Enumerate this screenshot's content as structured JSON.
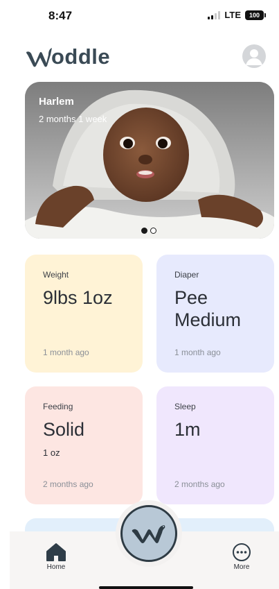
{
  "status_bar": {
    "time": "8:47",
    "network": "LTE",
    "battery": "100"
  },
  "header": {
    "brand_text": "oddle",
    "brand_full": "Woddle",
    "profile_icon": "user-avatar-icon"
  },
  "hero": {
    "name": "Harlem",
    "age": "2 months 1 week",
    "carousel": {
      "count": 2,
      "active_index": 0
    }
  },
  "cards": {
    "weight": {
      "title": "Weight",
      "value": "9lbs 1oz",
      "time": "1 month ago"
    },
    "diaper": {
      "title": "Diaper",
      "value": "Pee Medium",
      "time": "1 month ago"
    },
    "feeding": {
      "title": "Feeding",
      "value": "Solid",
      "sub": "1 oz",
      "time": "2 months ago"
    },
    "sleep": {
      "title": "Sleep",
      "value": "1m",
      "time": "2 months ago"
    }
  },
  "nav": {
    "home_label": "Home",
    "more_label": "More",
    "home_icon": "home-icon",
    "more_icon": "more-icon",
    "center_icon": "woddle-logo-icon"
  },
  "colors": {
    "brand": "#3a4a55",
    "weight_bg": "#fff3d6",
    "diaper_bg": "#e7eafd",
    "feeding_bg": "#fde6e2",
    "sleep_bg": "#f0e7fd",
    "fab_bg": "#b8c8d6"
  }
}
